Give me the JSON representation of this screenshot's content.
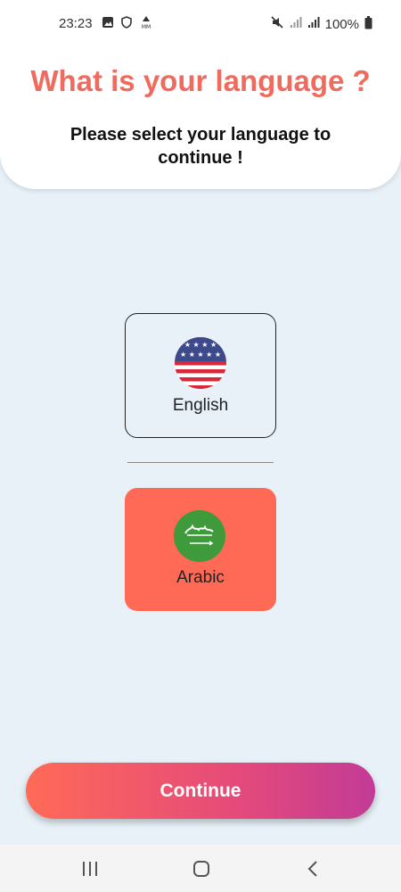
{
  "status_bar": {
    "time": "23:23",
    "battery": "100%",
    "icons": [
      "image-icon",
      "shield-icon",
      "mm-icon",
      "mute-icon",
      "signal-icon",
      "signal-icon",
      "battery-icon"
    ]
  },
  "header": {
    "title": "What is your language ?",
    "subtitle": "Please select your language to continue !"
  },
  "languages": [
    {
      "label": "English",
      "flag": "us-flag-icon",
      "selected": false
    },
    {
      "label": "Arabic",
      "flag": "saudi-flag-icon",
      "selected": true
    }
  ],
  "continue_label": "Continue",
  "colors": {
    "accent": "#f06a5e",
    "selected_card": "#ff6a57",
    "background": "#e8f1f8",
    "gradient_end": "#c23b96"
  },
  "nav_bar": {
    "icons": [
      "recents-icon",
      "home-icon",
      "back-icon"
    ]
  }
}
